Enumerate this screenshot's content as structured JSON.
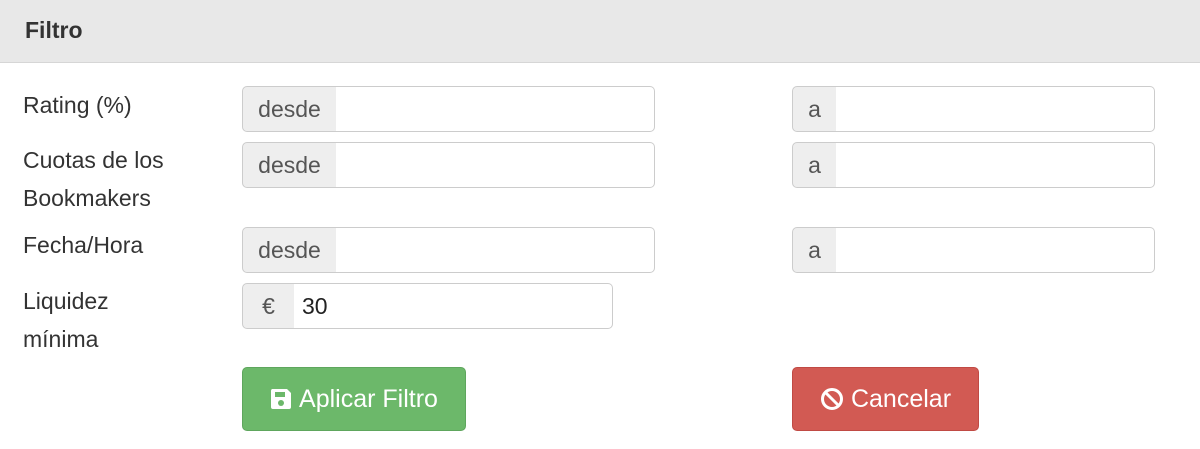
{
  "panel": {
    "title": "Filtro"
  },
  "rows": {
    "rating": {
      "label": "Rating (%)",
      "from_addon": "desde",
      "from_value": "",
      "to_addon": "a",
      "to_value": ""
    },
    "odds": {
      "label": "Cuotas de los Bookmakers",
      "from_addon": "desde",
      "from_value": "",
      "to_addon": "a",
      "to_value": ""
    },
    "datetime": {
      "label": "Fecha/Hora",
      "from_addon": "desde",
      "from_value": "",
      "to_addon": "a",
      "to_value": ""
    },
    "liquidity": {
      "label": "Liquidez mínima",
      "addon": "€",
      "value": "30"
    }
  },
  "buttons": {
    "apply": {
      "label": "Aplicar Filtro",
      "icon": "save-icon",
      "color": "#6cb86a"
    },
    "cancel": {
      "label": "Cancelar",
      "icon": "ban-icon",
      "color": "#d25a53"
    }
  }
}
